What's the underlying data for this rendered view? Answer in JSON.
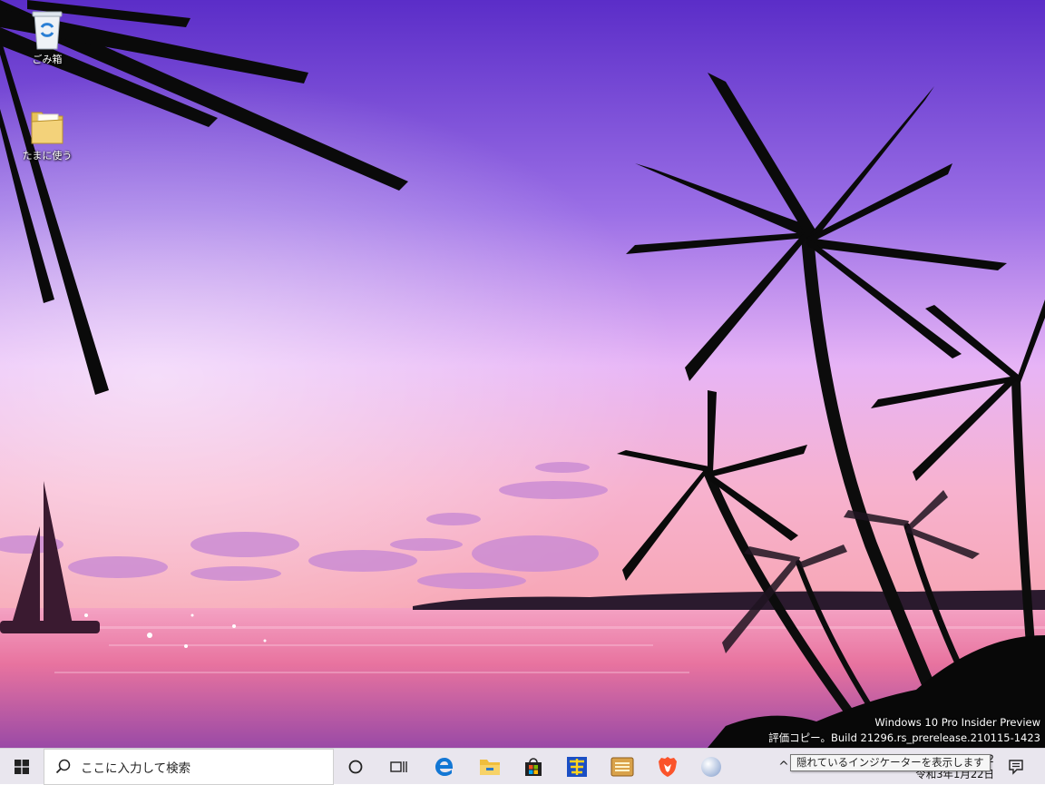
{
  "desktop": {
    "icons": [
      {
        "label": "ごみ箱",
        "icon": "recycle-bin-icon"
      },
      {
        "label": "たまに使う",
        "icon": "folder-icon"
      }
    ],
    "watermark": {
      "line1": "Windows 10 Pro Insider Preview",
      "line2": "評価コピー。Build 21296.rs_prerelease.210115-1423"
    }
  },
  "taskbar": {
    "search_placeholder": "ここに入力して検索",
    "pinned_apps": [
      "edge-icon",
      "file-explorer-icon",
      "store-icon",
      "hidemaru-icon",
      "app-icon",
      "brave-icon",
      "sphere-icon"
    ],
    "tray": {
      "chevron": "^",
      "tooltip": "隠れているインジケーターを表示します",
      "time_fragment": "2",
      "date": "令和3年1月22日"
    }
  },
  "colors": {
    "sky_top": "#5a2ec4",
    "sky_mid": "#c88ef0",
    "horizon": "#f2a4c8",
    "sea": "#e0609c",
    "taskbar": "#e9e6ee"
  }
}
